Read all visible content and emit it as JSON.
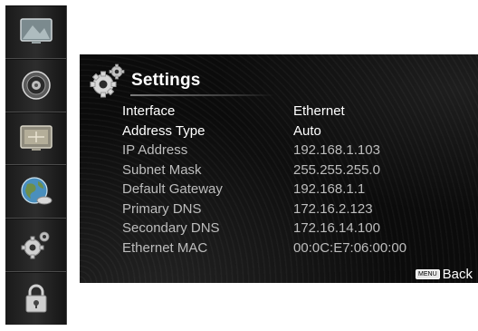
{
  "sidebar": {
    "items": [
      {
        "icon": "picture-icon"
      },
      {
        "icon": "speaker-icon"
      },
      {
        "icon": "screen-adjust-icon"
      },
      {
        "icon": "network-globe-icon"
      },
      {
        "icon": "settings-gear-icon",
        "selected": true
      },
      {
        "icon": "lock-icon"
      }
    ]
  },
  "panel": {
    "title": "Settings",
    "title_icon": "gears-icon",
    "rows": [
      {
        "label": "Interface",
        "value": "Ethernet"
      },
      {
        "label": "Address Type",
        "value": "Auto"
      },
      {
        "label": "IP Address",
        "value": "192.168.1.103"
      },
      {
        "label": "Subnet Mask",
        "value": "255.255.255.0"
      },
      {
        "label": "Default Gateway",
        "value": "192.168.1.1"
      },
      {
        "label": "Primary DNS",
        "value": "172.16.2.123"
      },
      {
        "label": "Secondary DNS",
        "value": "172.16.14.100"
      },
      {
        "label": "Ethernet MAC",
        "value": "00:0C:E7:06:00:00"
      }
    ],
    "footer": {
      "key_label": "MENU",
      "back_label": "Back"
    }
  },
  "colors": {
    "panel_bg": "#0b0b0b",
    "text_primary": "#ffffff",
    "text_dim": "#bdbdbd"
  }
}
